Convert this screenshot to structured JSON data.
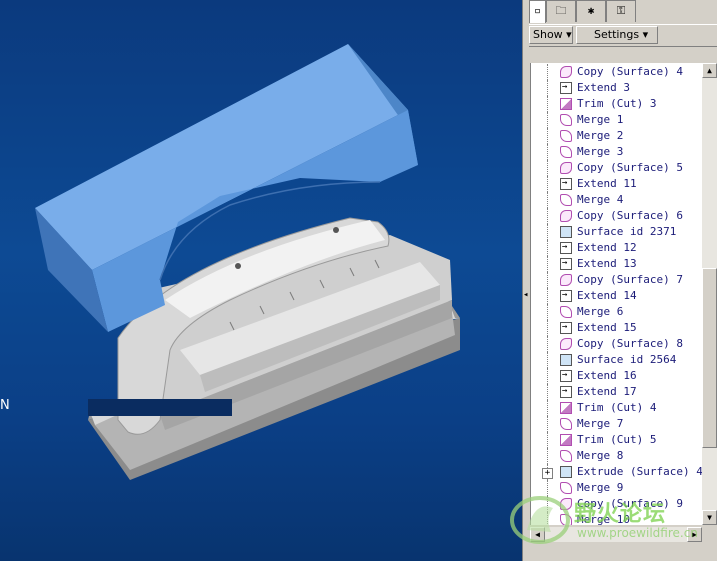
{
  "viewport": {
    "edge_letter": "N"
  },
  "panel": {
    "tabs": [
      {
        "name": "model-tree-tab",
        "glyph": "▫"
      },
      {
        "name": "folder-browser-tab",
        "glyph": "🗀"
      },
      {
        "name": "favorites-tab",
        "glyph": "✱"
      },
      {
        "name": "connections-tab",
        "glyph": "⚿"
      }
    ],
    "toolbar": {
      "show_label": "Show ▾",
      "settings_label": "Settings ▾"
    },
    "tree_items": [
      {
        "label": "Copy (Surface) 4",
        "icon": "surface"
      },
      {
        "label": "Extend 3",
        "icon": "extend"
      },
      {
        "label": "Trim (Cut) 3",
        "icon": "trim"
      },
      {
        "label": "Merge 1",
        "icon": "merge"
      },
      {
        "label": "Merge 2",
        "icon": "merge"
      },
      {
        "label": "Merge 3",
        "icon": "merge"
      },
      {
        "label": "Copy (Surface) 5",
        "icon": "surface"
      },
      {
        "label": "Extend 11",
        "icon": "extend"
      },
      {
        "label": "Merge 4",
        "icon": "merge"
      },
      {
        "label": "Copy (Surface) 6",
        "icon": "surface"
      },
      {
        "label": "Surface id 2371",
        "icon": "plain"
      },
      {
        "label": "Extend 12",
        "icon": "extend"
      },
      {
        "label": "Extend 13",
        "icon": "extend"
      },
      {
        "label": "Copy (Surface) 7",
        "icon": "surface"
      },
      {
        "label": "Extend 14",
        "icon": "extend"
      },
      {
        "label": "Merge 6",
        "icon": "merge"
      },
      {
        "label": "Extend 15",
        "icon": "extend"
      },
      {
        "label": "Copy (Surface) 8",
        "icon": "surface"
      },
      {
        "label": "Surface id 2564",
        "icon": "plain"
      },
      {
        "label": "Extend 16",
        "icon": "extend"
      },
      {
        "label": "Extend 17",
        "icon": "extend"
      },
      {
        "label": "Trim (Cut) 4",
        "icon": "trim"
      },
      {
        "label": "Merge 7",
        "icon": "merge"
      },
      {
        "label": "Trim (Cut) 5",
        "icon": "trim"
      },
      {
        "label": "Merge 8",
        "icon": "merge"
      },
      {
        "label": "Extrude (Surface) 4",
        "icon": "extrude",
        "expandable": true
      },
      {
        "label": "Merge 9",
        "icon": "merge"
      },
      {
        "label": "Copy (Surface) 9",
        "icon": "surface"
      },
      {
        "label": "Merge 10",
        "icon": "merge"
      }
    ]
  },
  "watermark": {
    "text": "野火论坛",
    "url": "www.proewildfire.cn"
  },
  "colors": {
    "viewport_bg": "#0d4a94",
    "part_blue": "#5b9be0",
    "part_gray": "#c8c8c8"
  }
}
